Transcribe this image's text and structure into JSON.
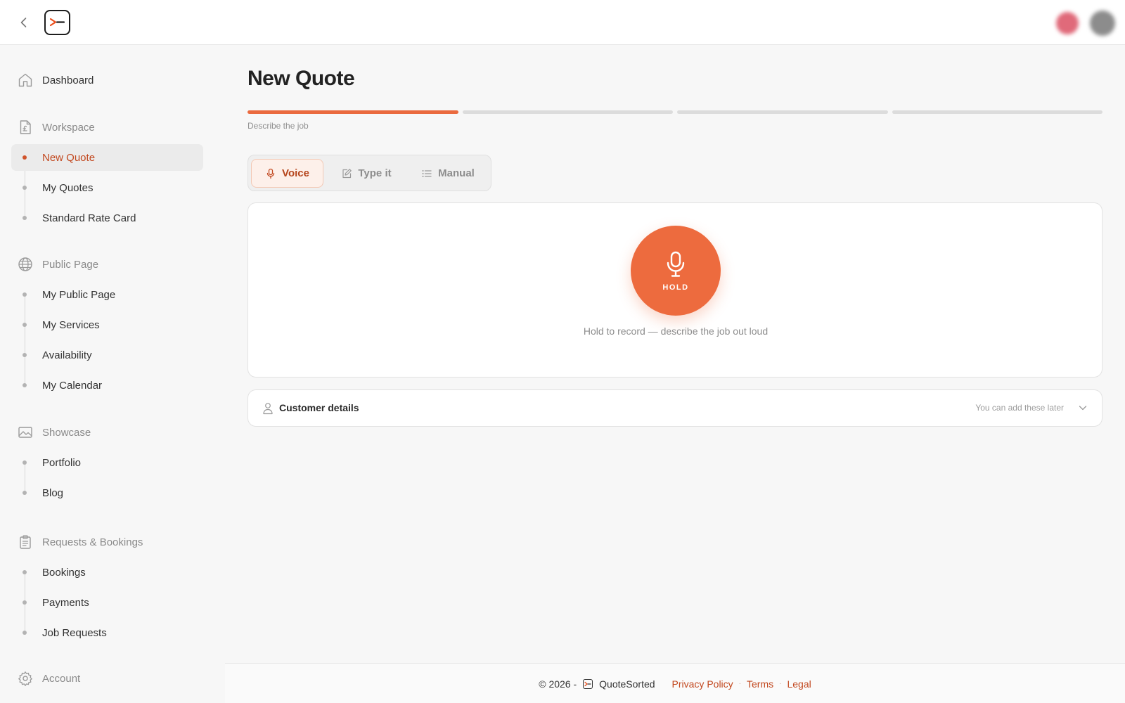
{
  "topbar": {
    "back_icon": "chevron-left-icon",
    "logo_icon": "terminal-logo-icon"
  },
  "sidebar": {
    "dashboard": {
      "label": "Dashboard",
      "icon": "home-icon"
    },
    "sections": [
      {
        "label": "Workspace",
        "icon": "invoice-pound-icon",
        "items": [
          {
            "label": "New Quote",
            "active": true
          },
          {
            "label": "My Quotes"
          },
          {
            "label": "Standard Rate Card"
          }
        ]
      },
      {
        "label": "Public Page",
        "icon": "globe-icon",
        "items": [
          {
            "label": "My Public Page"
          },
          {
            "label": "My Services"
          },
          {
            "label": "Availability"
          },
          {
            "label": "My Calendar"
          }
        ]
      },
      {
        "label": "Showcase",
        "icon": "image-icon",
        "items": [
          {
            "label": "Portfolio"
          },
          {
            "label": "Blog"
          }
        ]
      },
      {
        "label": "Requests & Bookings",
        "icon": "clipboard-icon",
        "items": [
          {
            "label": "Bookings"
          },
          {
            "label": "Payments"
          },
          {
            "label": "Job Requests"
          }
        ]
      },
      {
        "label": "Account",
        "icon": "gear-icon",
        "items": []
      }
    ]
  },
  "main": {
    "title": "New Quote",
    "progress": {
      "total_steps": 4,
      "current_step": 1
    },
    "step_label": "Describe the job",
    "tabs": [
      {
        "label": "Voice",
        "icon": "microphone-icon",
        "active": true
      },
      {
        "label": "Type it",
        "icon": "pencil-icon"
      },
      {
        "label": "Manual",
        "icon": "list-icon"
      }
    ],
    "voice": {
      "button_label": "HOLD",
      "hint": "Hold to record — describe the job out loud"
    },
    "customer": {
      "title": "Customer details",
      "hint": "You can add these later"
    }
  },
  "footer": {
    "copyright": "© 2026 -",
    "brand": "QuoteSorted",
    "links": [
      "Privacy Policy",
      "Terms",
      "Legal"
    ]
  },
  "colors": {
    "accent": "#ed6b3e",
    "accent_text": "#c2481f",
    "background": "#f7f7f7"
  }
}
